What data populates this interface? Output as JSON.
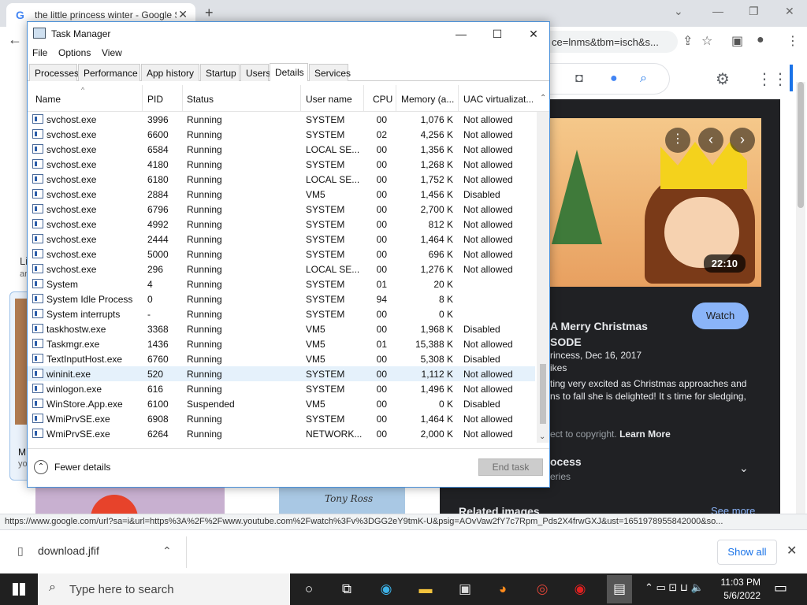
{
  "browser": {
    "tab_title": "the little princess winter - Google Search",
    "tab_favicon": "G",
    "new_tab": "+",
    "omnibox_text": "ce=lnms&tbm=isch&s...",
    "status_url": "https://www.google.com/url?sa=i&url=https%3A%2F%2Fwww.youtube.com%2Fwatch%3Fv%3DGG2eY9tmK-U&psig=AOvVaw2fY7c7Rpm_Pds2X4frwGXJ&ust=1651978955842000&so...",
    "download_file": "download.jfif",
    "show_all": "Show all"
  },
  "google": {
    "video_duration": "22:10",
    "watch_label": "Watch",
    "panel_title_1": "A Merry Christmas",
    "panel_title_2": "SODE",
    "panel_meta_1": "rincess, Dec 16, 2017",
    "panel_meta_2": "ikes",
    "panel_desc_1": "ting very excited as Christmas approaches and",
    "panel_desc_2": "ns to fall she is delighted! It s time for sledging,",
    "copyright": "ect to copyright.",
    "learn_more": "Learn More",
    "process_title": "ocess",
    "process_sub": "eries",
    "related_images": "Related images",
    "see_more": "See more",
    "left_label_1": "Li",
    "left_label_2": "ar",
    "left_card_1": "M",
    "left_card_2": "yo",
    "thumb_text": "Tony Ross"
  },
  "taskbar": {
    "search_placeholder": "Type here to search",
    "time": "11:03 PM",
    "date": "5/6/2022"
  },
  "taskmanager": {
    "title": "Task Manager",
    "menu": [
      "File",
      "Options",
      "View"
    ],
    "tabs": [
      "Processes",
      "Performance",
      "App history",
      "Startup",
      "Users",
      "Details",
      "Services"
    ],
    "active_tab": "Details",
    "columns": [
      "Name",
      "PID",
      "Status",
      "User name",
      "CPU",
      "Memory (a...",
      "UAC virtualizat..."
    ],
    "rows": [
      {
        "name": "svchost.exe",
        "pid": "3996",
        "status": "Running",
        "user": "SYSTEM",
        "cpu": "00",
        "mem": "1,076 K",
        "uac": "Not allowed"
      },
      {
        "name": "svchost.exe",
        "pid": "6600",
        "status": "Running",
        "user": "SYSTEM",
        "cpu": "02",
        "mem": "4,256 K",
        "uac": "Not allowed"
      },
      {
        "name": "svchost.exe",
        "pid": "6584",
        "status": "Running",
        "user": "LOCAL SE...",
        "cpu": "00",
        "mem": "1,356 K",
        "uac": "Not allowed"
      },
      {
        "name": "svchost.exe",
        "pid": "4180",
        "status": "Running",
        "user": "SYSTEM",
        "cpu": "00",
        "mem": "1,268 K",
        "uac": "Not allowed"
      },
      {
        "name": "svchost.exe",
        "pid": "6180",
        "status": "Running",
        "user": "LOCAL SE...",
        "cpu": "00",
        "mem": "1,752 K",
        "uac": "Not allowed"
      },
      {
        "name": "svchost.exe",
        "pid": "2884",
        "status": "Running",
        "user": "VM5",
        "cpu": "00",
        "mem": "1,456 K",
        "uac": "Disabled"
      },
      {
        "name": "svchost.exe",
        "pid": "6796",
        "status": "Running",
        "user": "SYSTEM",
        "cpu": "00",
        "mem": "2,700 K",
        "uac": "Not allowed"
      },
      {
        "name": "svchost.exe",
        "pid": "4992",
        "status": "Running",
        "user": "SYSTEM",
        "cpu": "00",
        "mem": "812 K",
        "uac": "Not allowed"
      },
      {
        "name": "svchost.exe",
        "pid": "2444",
        "status": "Running",
        "user": "SYSTEM",
        "cpu": "00",
        "mem": "1,464 K",
        "uac": "Not allowed"
      },
      {
        "name": "svchost.exe",
        "pid": "5000",
        "status": "Running",
        "user": "SYSTEM",
        "cpu": "00",
        "mem": "696 K",
        "uac": "Not allowed"
      },
      {
        "name": "svchost.exe",
        "pid": "296",
        "status": "Running",
        "user": "LOCAL SE...",
        "cpu": "00",
        "mem": "1,276 K",
        "uac": "Not allowed"
      },
      {
        "name": "System",
        "pid": "4",
        "status": "Running",
        "user": "SYSTEM",
        "cpu": "01",
        "mem": "20 K",
        "uac": ""
      },
      {
        "name": "System Idle Process",
        "pid": "0",
        "status": "Running",
        "user": "SYSTEM",
        "cpu": "94",
        "mem": "8 K",
        "uac": ""
      },
      {
        "name": "System interrupts",
        "pid": "-",
        "status": "Running",
        "user": "SYSTEM",
        "cpu": "00",
        "mem": "0 K",
        "uac": ""
      },
      {
        "name": "taskhostw.exe",
        "pid": "3368",
        "status": "Running",
        "user": "VM5",
        "cpu": "00",
        "mem": "1,968 K",
        "uac": "Disabled"
      },
      {
        "name": "Taskmgr.exe",
        "pid": "1436",
        "status": "Running",
        "user": "VM5",
        "cpu": "01",
        "mem": "15,388 K",
        "uac": "Not allowed"
      },
      {
        "name": "TextInputHost.exe",
        "pid": "6760",
        "status": "Running",
        "user": "VM5",
        "cpu": "00",
        "mem": "5,308 K",
        "uac": "Disabled"
      },
      {
        "name": "wininit.exe",
        "pid": "520",
        "status": "Running",
        "user": "SYSTEM",
        "cpu": "00",
        "mem": "1,112 K",
        "uac": "Not allowed"
      },
      {
        "name": "winlogon.exe",
        "pid": "616",
        "status": "Running",
        "user": "SYSTEM",
        "cpu": "00",
        "mem": "1,496 K",
        "uac": "Not allowed"
      },
      {
        "name": "WinStore.App.exe",
        "pid": "6100",
        "status": "Suspended",
        "user": "VM5",
        "cpu": "00",
        "mem": "0 K",
        "uac": "Disabled"
      },
      {
        "name": "WmiPrvSE.exe",
        "pid": "6908",
        "status": "Running",
        "user": "SYSTEM",
        "cpu": "00",
        "mem": "1,464 K",
        "uac": "Not allowed"
      },
      {
        "name": "WmiPrvSE.exe",
        "pid": "6264",
        "status": "Running",
        "user": "NETWORK...",
        "cpu": "00",
        "mem": "2,000 K",
        "uac": "Not allowed"
      }
    ],
    "selected_row": 17,
    "fewer_details": "Fewer details",
    "end_task": "End task"
  }
}
